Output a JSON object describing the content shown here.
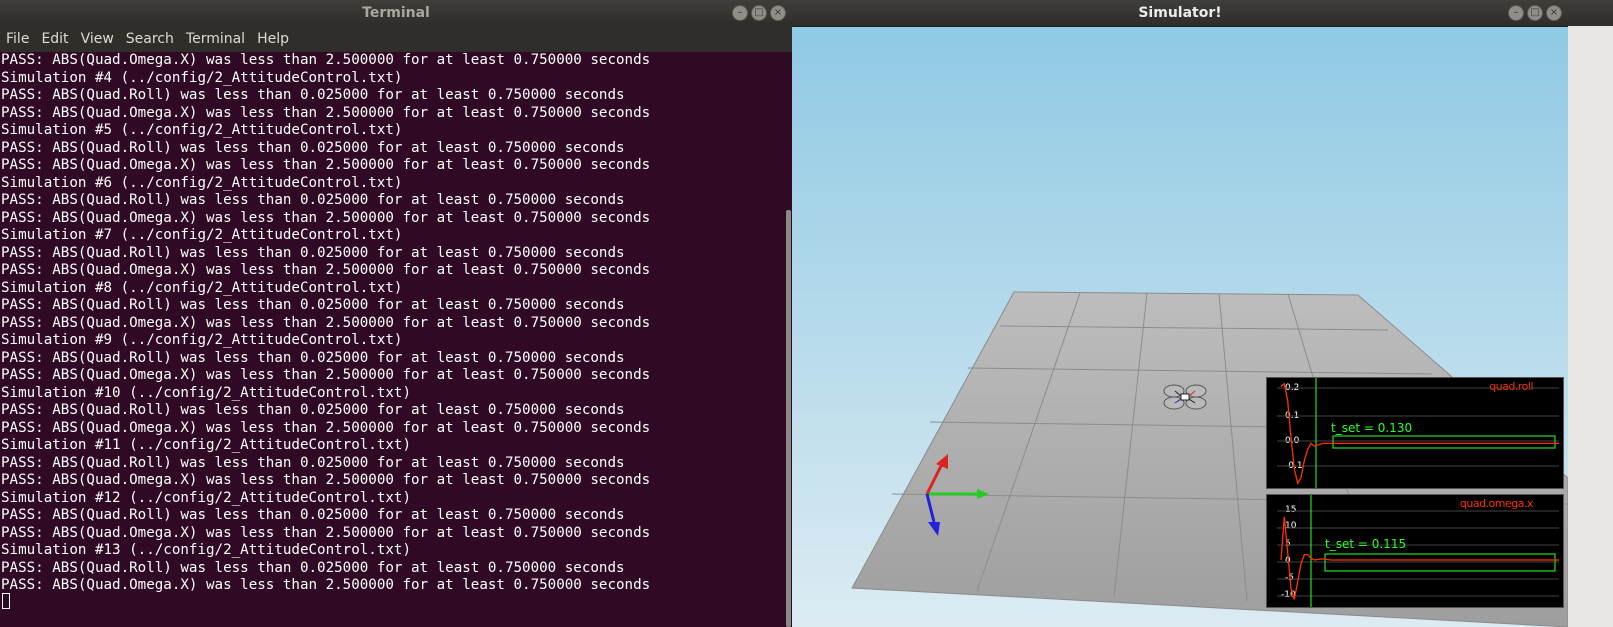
{
  "terminal": {
    "title": "Terminal",
    "menu": [
      "File",
      "Edit",
      "View",
      "Search",
      "Terminal",
      "Help"
    ],
    "lines": [
      "PASS: ABS(Quad.Omega.X) was less than 2.500000 for at least 0.750000 seconds",
      "Simulation #4 (../config/2_AttitudeControl.txt)",
      "PASS: ABS(Quad.Roll) was less than 0.025000 for at least 0.750000 seconds",
      "PASS: ABS(Quad.Omega.X) was less than 2.500000 for at least 0.750000 seconds",
      "Simulation #5 (../config/2_AttitudeControl.txt)",
      "PASS: ABS(Quad.Roll) was less than 0.025000 for at least 0.750000 seconds",
      "PASS: ABS(Quad.Omega.X) was less than 2.500000 for at least 0.750000 seconds",
      "Simulation #6 (../config/2_AttitudeControl.txt)",
      "PASS: ABS(Quad.Roll) was less than 0.025000 for at least 0.750000 seconds",
      "PASS: ABS(Quad.Omega.X) was less than 2.500000 for at least 0.750000 seconds",
      "Simulation #7 (../config/2_AttitudeControl.txt)",
      "PASS: ABS(Quad.Roll) was less than 0.025000 for at least 0.750000 seconds",
      "PASS: ABS(Quad.Omega.X) was less than 2.500000 for at least 0.750000 seconds",
      "Simulation #8 (../config/2_AttitudeControl.txt)",
      "PASS: ABS(Quad.Roll) was less than 0.025000 for at least 0.750000 seconds",
      "PASS: ABS(Quad.Omega.X) was less than 2.500000 for at least 0.750000 seconds",
      "Simulation #9 (../config/2_AttitudeControl.txt)",
      "PASS: ABS(Quad.Roll) was less than 0.025000 for at least 0.750000 seconds",
      "PASS: ABS(Quad.Omega.X) was less than 2.500000 for at least 0.750000 seconds",
      "Simulation #10 (../config/2_AttitudeControl.txt)",
      "PASS: ABS(Quad.Roll) was less than 0.025000 for at least 0.750000 seconds",
      "PASS: ABS(Quad.Omega.X) was less than 2.500000 for at least 0.750000 seconds",
      "Simulation #11 (../config/2_AttitudeControl.txt)",
      "PASS: ABS(Quad.Roll) was less than 0.025000 for at least 0.750000 seconds",
      "PASS: ABS(Quad.Omega.X) was less than 2.500000 for at least 0.750000 seconds",
      "Simulation #12 (../config/2_AttitudeControl.txt)",
      "PASS: ABS(Quad.Roll) was less than 0.025000 for at least 0.750000 seconds",
      "PASS: ABS(Quad.Omega.X) was less than 2.500000 for at least 0.750000 seconds",
      "Simulation #13 (../config/2_AttitudeControl.txt)",
      "PASS: ABS(Quad.Roll) was less than 0.025000 for at least 0.750000 seconds",
      "PASS: ABS(Quad.Omega.X) was less than 2.500000 for at least 0.750000 seconds"
    ],
    "colors": {
      "background": "#300a24",
      "text": "#ffffff"
    }
  },
  "simulator": {
    "title": "Simulator!",
    "colors": {
      "sky_top": "#8cc8e3",
      "ground": "#a8a8a8",
      "axis_x": "#22cc22",
      "axis_y": "#dd2222",
      "axis_z": "#2222dd"
    },
    "plots": [
      {
        "name": "quad.roll",
        "title": "quad.roll",
        "y_ticks": [
          "0.2",
          "0.1",
          "0.0",
          "-0.1"
        ],
        "t_set_text": "t_set = 0.130"
      },
      {
        "name": "quad.omega.x",
        "title": "quad.omega.x",
        "y_ticks": [
          "15",
          "10",
          "5",
          "0",
          "-5",
          "-10"
        ],
        "t_set_text": "t_set = 0.115"
      }
    ]
  },
  "chart_data": [
    {
      "type": "line",
      "title": "quad.roll",
      "y_ticks": [
        "0.2",
        "0.1",
        "0.0",
        "-0.1"
      ],
      "ylim": [
        -0.15,
        0.23
      ],
      "series": [
        {
          "name": "quad.roll",
          "color": "#ff3300",
          "x": [
            0.0,
            0.02,
            0.04,
            0.06,
            0.08,
            0.1,
            0.12,
            0.14,
            0.16,
            0.18,
            0.2,
            0.25,
            0.3,
            0.5,
            1.0,
            1.5,
            2.0
          ],
          "y": [
            0.2,
            0.21,
            0.15,
            0.02,
            -0.09,
            -0.14,
            -0.12,
            -0.06,
            -0.02,
            0.0,
            -0.01,
            0.0,
            0.0,
            0.0,
            0.0,
            0.0,
            0.0
          ]
        }
      ],
      "settle_time": 0.13,
      "t_set_label": "t_set = 0.130",
      "band": [
        -0.025,
        0.025
      ],
      "annotations": [
        "t_set = 0.130"
      ]
    },
    {
      "type": "line",
      "title": "quad.omega.x",
      "y_ticks": [
        "15",
        "10",
        "5",
        "0",
        "-5",
        "-10"
      ],
      "ylim": [
        -12,
        17
      ],
      "series": [
        {
          "name": "quad.omega.x",
          "color": "#ff3300",
          "x": [
            0.0,
            0.02,
            0.04,
            0.06,
            0.08,
            0.1,
            0.12,
            0.14,
            0.16,
            0.18,
            0.2,
            0.25,
            0.3,
            0.5,
            1.0,
            1.5,
            2.0
          ],
          "y": [
            0.0,
            12.0,
            2.0,
            -8.0,
            -11.0,
            -6.0,
            -1.0,
            1.5,
            1.5,
            0.5,
            0.0,
            0.3,
            0.0,
            0.0,
            0.0,
            0.0,
            0.0
          ]
        }
      ],
      "settle_time": 0.115,
      "t_set_label": "t_set = 0.115",
      "band": [
        -2.5,
        2.5
      ],
      "annotations": [
        "t_set = 0.115"
      ]
    }
  ]
}
